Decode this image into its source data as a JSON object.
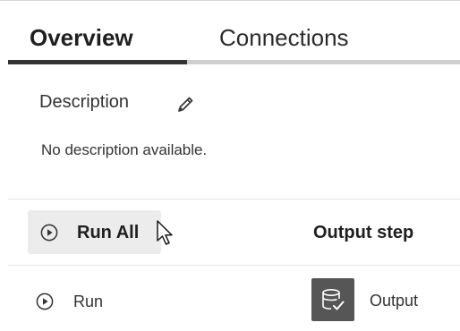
{
  "tabs": [
    {
      "label": "Overview",
      "active": true
    },
    {
      "label": "Connections",
      "active": false
    }
  ],
  "description": {
    "label": "Description",
    "text": "No description available.",
    "edit_icon": "pencil-icon"
  },
  "toolbar": {
    "run_all_label": "Run All",
    "play_icon": "play-circle-icon"
  },
  "table": {
    "columns": [
      "Output step"
    ],
    "rows": [
      {
        "action_label": "Run",
        "step_label": "Output",
        "step_icon": "database-check-icon"
      }
    ]
  },
  "colors": {
    "active_tab_indicator": "#333333",
    "tab_track": "#cfcfcf",
    "button_bg": "#ececec",
    "output_tile": "#565656"
  }
}
